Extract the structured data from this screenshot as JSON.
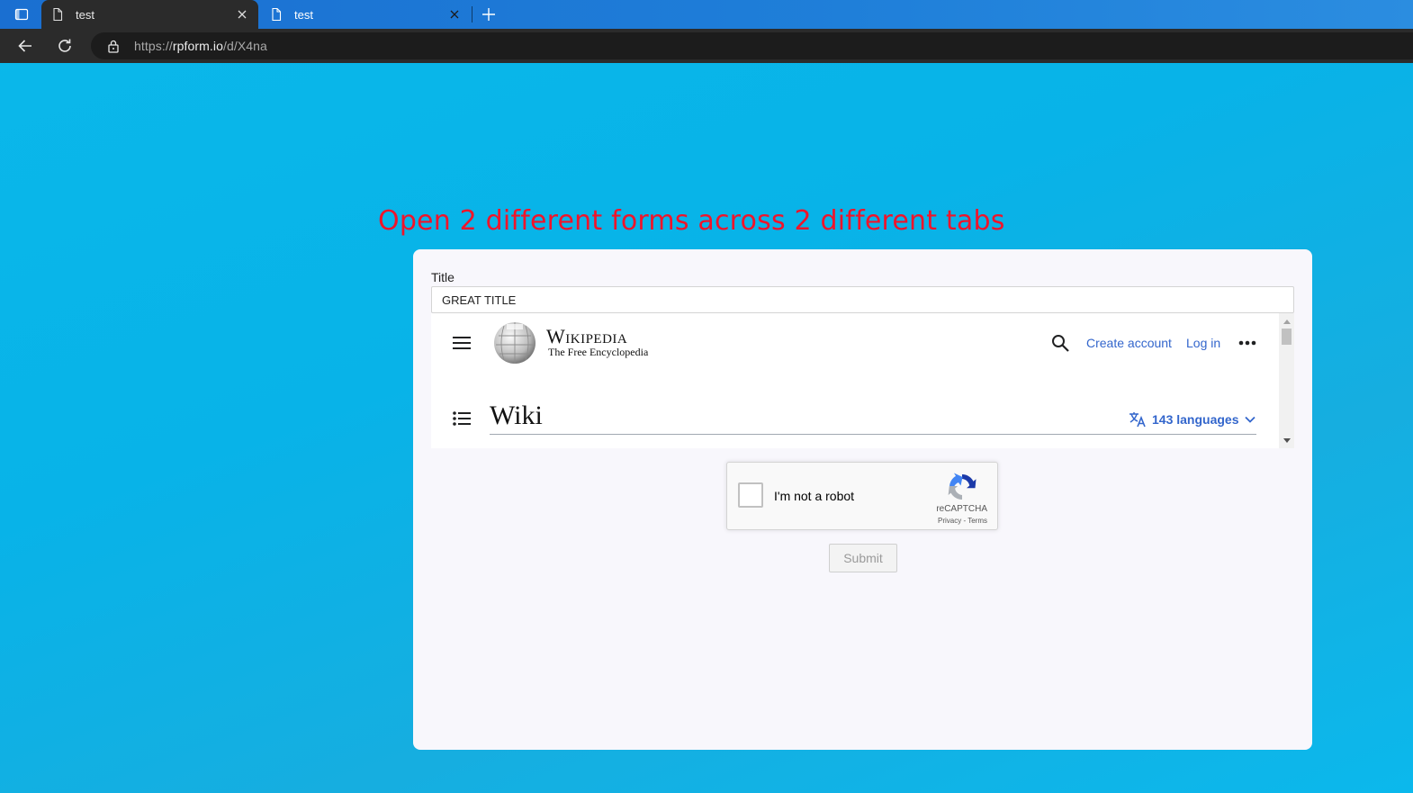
{
  "browser": {
    "tabs": [
      {
        "title": "test",
        "active": true
      },
      {
        "title": "test",
        "active": false
      }
    ],
    "url_scheme": "https://",
    "url_host": "rpform.io",
    "url_path": "/d/X4na"
  },
  "page": {
    "instruction": "Open 2 different forms across 2 different tabs",
    "form": {
      "title_label": "Title",
      "title_value": "GREAT TITLE"
    }
  },
  "wikipedia": {
    "wordmark": "Wikipedia",
    "tagline": "The Free Encyclopedia",
    "create_account": "Create account",
    "log_in": "Log in",
    "heading": "Wiki",
    "languages": "143 languages"
  },
  "recaptcha": {
    "label": "I'm not a robot",
    "brand": "reCAPTCHA",
    "links": "Privacy - Terms"
  },
  "submit_label": "Submit",
  "colors": {
    "instruction": "#f0142a",
    "wiki_link": "#3366cc",
    "tabstrip": "#1f7fd9",
    "toolbar": "#2b2b2b"
  }
}
